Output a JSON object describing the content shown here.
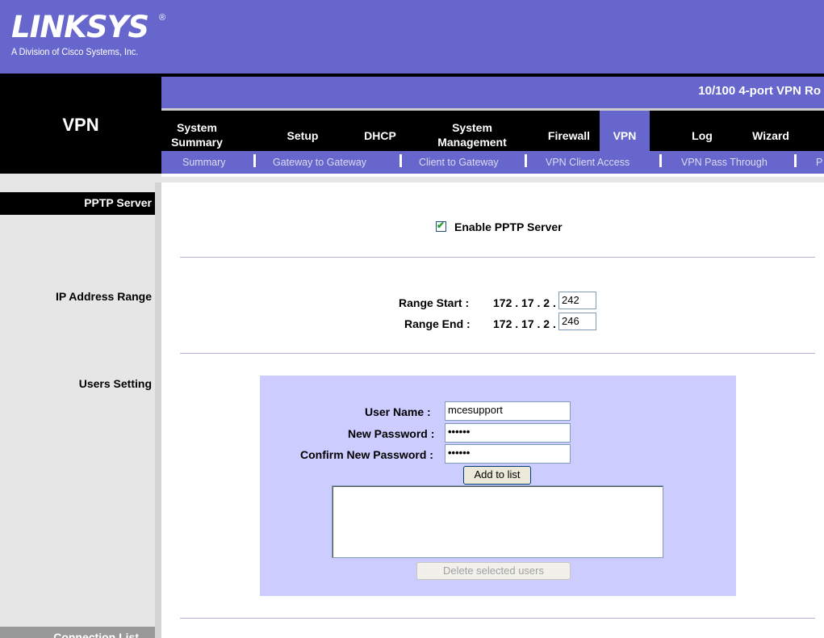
{
  "header": {
    "logo": "LINKSYS",
    "registered_mark": "®",
    "tagline": "A Division of Cisco Systems, Inc.",
    "product": "10/100 4-port VPN Ro",
    "section": "VPN"
  },
  "tabs": [
    {
      "line1": "System",
      "line2": "Summary"
    },
    {
      "label": "Setup"
    },
    {
      "label": "DHCP"
    },
    {
      "line1": "System",
      "line2": "Management"
    },
    {
      "label": "Firewall"
    },
    {
      "label": "VPN"
    },
    {
      "label": "Log"
    },
    {
      "label": "Wizard"
    }
  ],
  "subnav": [
    "Summary",
    "Gateway to Gateway",
    "Client to Gateway",
    "VPN Client Access",
    "VPN Pass Through",
    "P"
  ],
  "sidebar": {
    "pptp": "PPTP Server",
    "ip_range": "IP Address Range",
    "users": "Users Setting",
    "connection": "Connection List"
  },
  "pptp": {
    "enable_label": "Enable PPTP Server",
    "enabled": true
  },
  "range": {
    "start_label": "Range Start :",
    "end_label": "Range End :",
    "prefix": "172 . 17 . 2 .",
    "start_value": "242",
    "end_value": "246"
  },
  "users": {
    "username_label": "User Name :",
    "username_value": "mcesupport",
    "password_label": "New Password :",
    "password_value": "••••••",
    "confirm_label": "Confirm New Password :",
    "confirm_value": "••••••",
    "add_button": "Add to list",
    "delete_button": "Delete selected users"
  },
  "colors": {
    "brand": "#6666cc",
    "panel": "#ccccff",
    "sidebar": "#e6e6e6"
  }
}
